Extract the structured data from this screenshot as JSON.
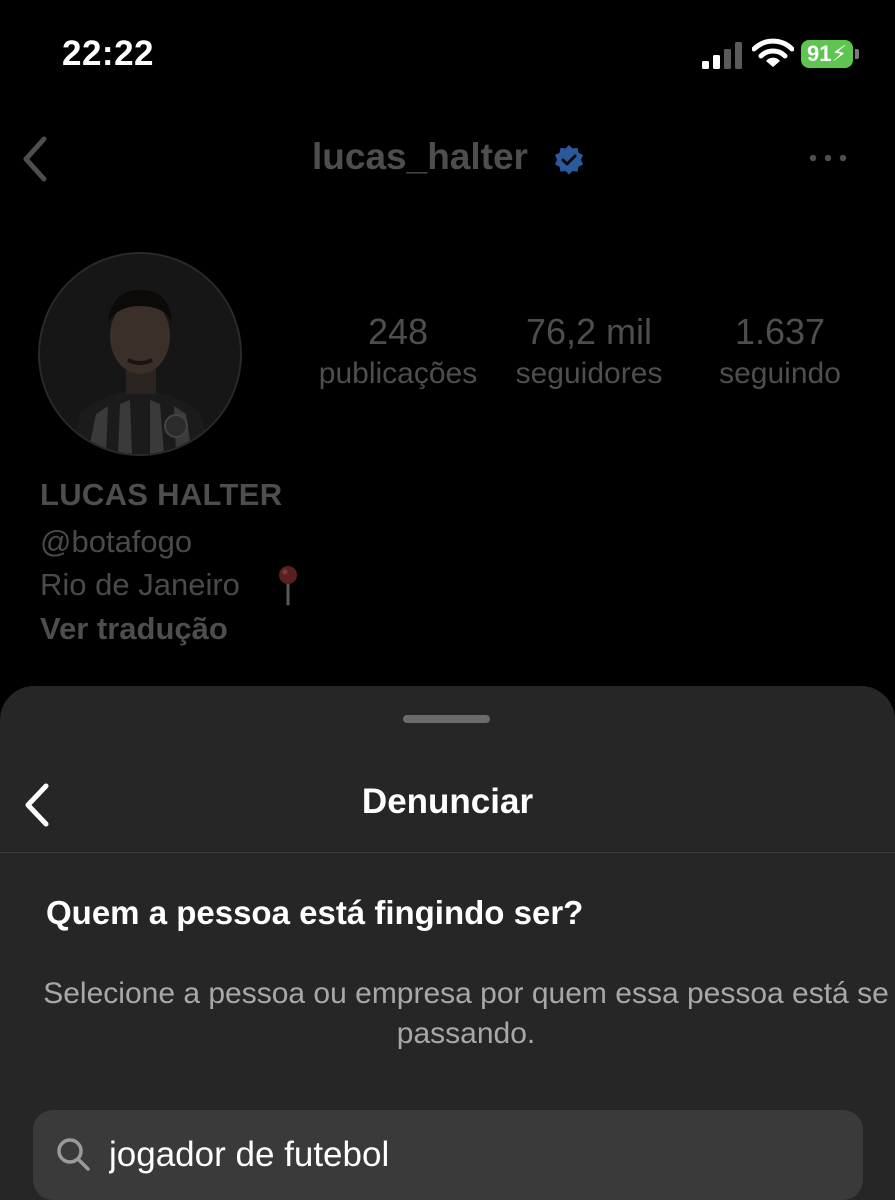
{
  "status_bar": {
    "time": "22:22",
    "battery_level": "91",
    "icons": [
      "signal-icon",
      "wifi-icon",
      "battery-charging-icon"
    ]
  },
  "profile": {
    "username": "lucas_halter",
    "verified": true,
    "stats": {
      "posts_value": "248",
      "posts_label": "publicações",
      "followers_value": "76,2 mil",
      "followers_label": "seguidores",
      "following_value": "1.637",
      "following_label": "seguindo"
    },
    "bio": {
      "name": "LUCAS HALTER",
      "handle": "@botafogo",
      "location": "Rio de Janeiro",
      "translate_link": "Ver tradução"
    },
    "icons": [
      "back-chevron-icon",
      "verified-badge-icon",
      "more-options-icon",
      "pin-icon"
    ]
  },
  "report_sheet": {
    "title": "Denunciar",
    "question": "Quem a pessoa está fingindo ser?",
    "description": "Selecione a pessoa ou empresa por quem essa pessoa está se passando.",
    "search": {
      "value": "jogador de futebol",
      "placeholder": ""
    },
    "icons": [
      "back-chevron-icon",
      "search-icon"
    ]
  },
  "colors": {
    "background": "#000000",
    "sheet_background": "#262626",
    "search_background": "#3a3a3a",
    "dimmed_text": "#4e4e4e",
    "secondary_text": "#a8a8a8",
    "battery_green": "#5fc551",
    "verified_blue": "#2a5a9a"
  }
}
